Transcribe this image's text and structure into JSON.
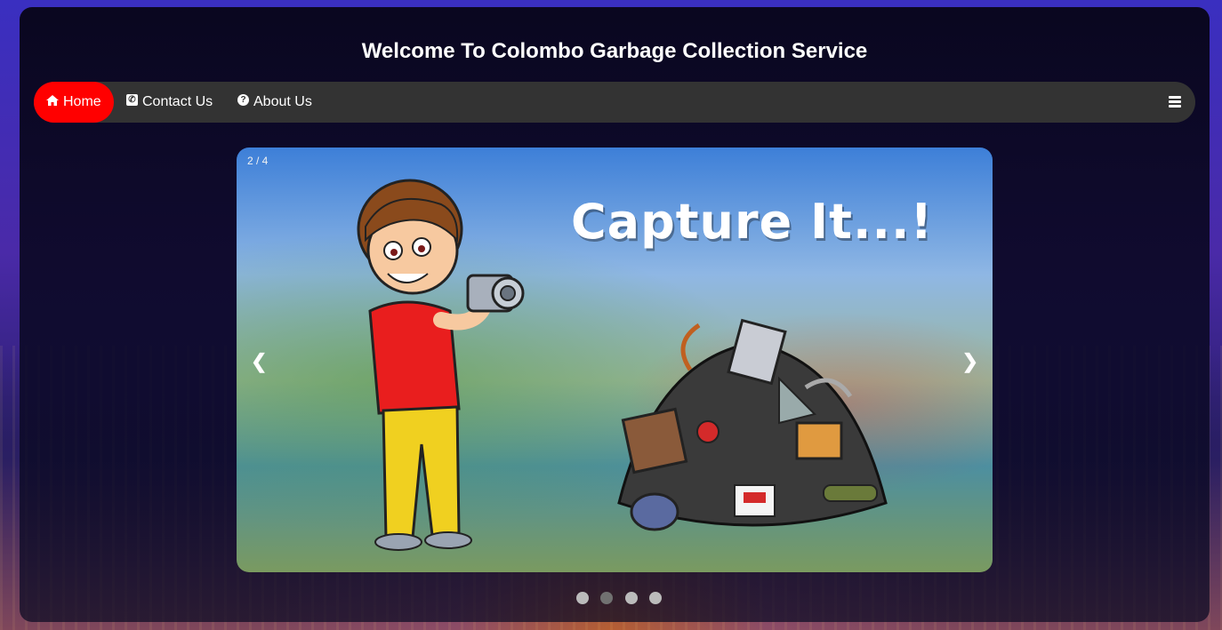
{
  "page": {
    "title": "Welcome To Colombo Garbage Collection Service"
  },
  "nav": {
    "items": [
      {
        "label": "Home",
        "icon": "home-icon",
        "active": true
      },
      {
        "label": "Contact Us",
        "icon": "phone-square-icon",
        "active": false
      },
      {
        "label": "About Us",
        "icon": "question-circle-icon",
        "active": false
      }
    ],
    "menu_icon": "bars-icon",
    "active_color": "#ff0000",
    "bar_color": "#333333"
  },
  "slideshow": {
    "counter": "2 / 4",
    "caption_art": "Capture It...!",
    "prev": "❮",
    "next": "❯",
    "total_slides": 4,
    "current_slide": 2
  }
}
